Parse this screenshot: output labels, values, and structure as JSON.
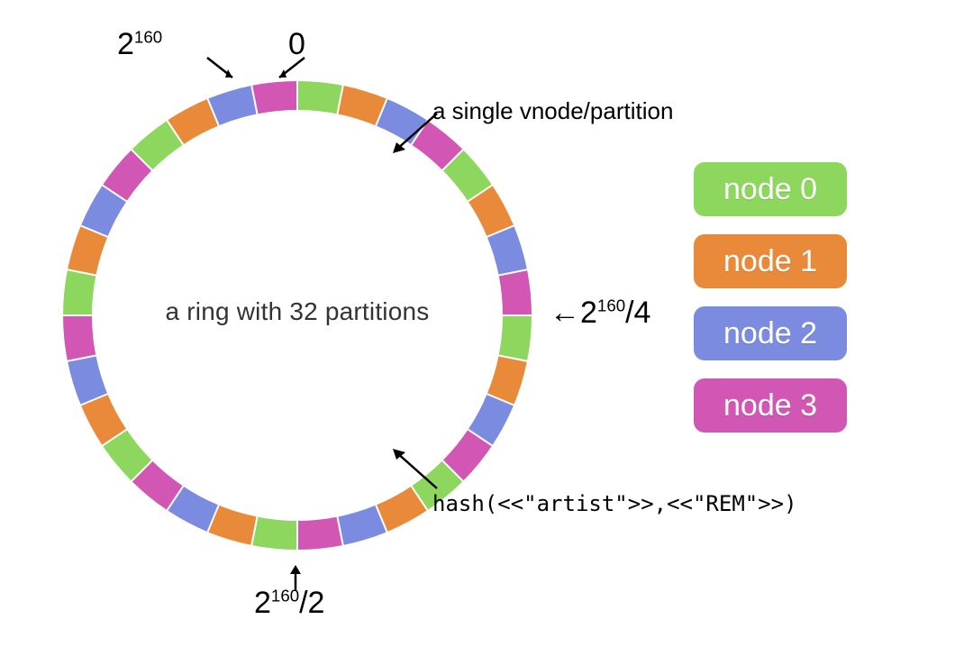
{
  "ring": {
    "partitions": 32,
    "center_label": "a ring with 32 partitions",
    "colors": [
      "#8dd75e",
      "#e98a3b",
      "#7b8ce0",
      "#d256b4"
    ]
  },
  "markers": {
    "zero": "0",
    "top_power_html": "2<sup>160</sup>",
    "right_html": "←2<sup>160</sup>/4",
    "bottom_html": "2<sup>160</sup>/2"
  },
  "annotations": {
    "vnode": "a single vnode/partition",
    "hash": "hash(<<\"artist\">>,<<\"REM\">>)"
  },
  "legend": [
    {
      "label": "node 0",
      "color": "#8dd75e"
    },
    {
      "label": "node 1",
      "color": "#e98a3b"
    },
    {
      "label": "node 2",
      "color": "#7b8ce0"
    },
    {
      "label": "node 3",
      "color": "#d256b4"
    }
  ],
  "chart_data": {
    "type": "pie",
    "title": "Consistent hashing ring with 32 partitions across 4 nodes",
    "categories": [
      "node 0",
      "node 1",
      "node 2",
      "node 3"
    ],
    "values": [
      8,
      8,
      8,
      8
    ],
    "partition_owners": [
      0,
      1,
      2,
      3,
      0,
      1,
      2,
      3,
      0,
      1,
      2,
      3,
      0,
      1,
      2,
      3,
      0,
      1,
      2,
      3,
      0,
      1,
      2,
      3,
      0,
      1,
      2,
      3,
      0,
      1,
      2,
      3
    ],
    "keyspace": "2^160",
    "labeled_points": [
      "0",
      "2^160/4",
      "2^160/2",
      "2^160"
    ],
    "example_hash_key": "hash(<<\"artist\">>,<<\"REM\">>)"
  }
}
